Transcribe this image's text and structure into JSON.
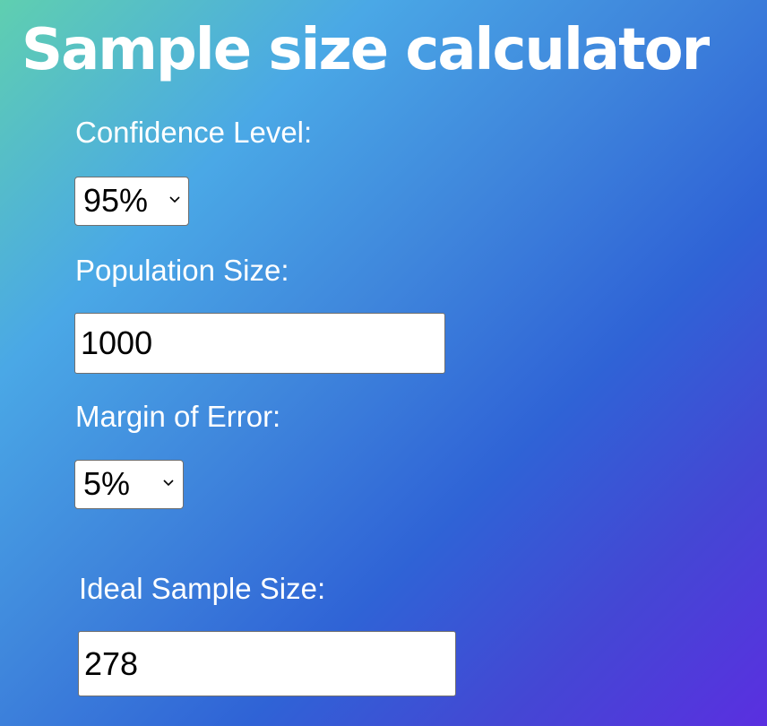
{
  "page": {
    "title": "Sample size calculator"
  },
  "form": {
    "confidence": {
      "label": "Confidence Level:",
      "selected": "95%"
    },
    "population": {
      "label": "Population Size:",
      "value": "1000"
    },
    "margin": {
      "label": "Margin of Error:",
      "selected": "5%"
    },
    "result": {
      "label": "Ideal Sample Size:",
      "value": "278"
    }
  },
  "icons": {
    "dropdown": "chevron-down-icon"
  },
  "colors": {
    "gradient_start": "#5fcfb0",
    "gradient_mid": "#2f63d6",
    "gradient_end": "#5a2fe0",
    "text": "#ffffff"
  }
}
